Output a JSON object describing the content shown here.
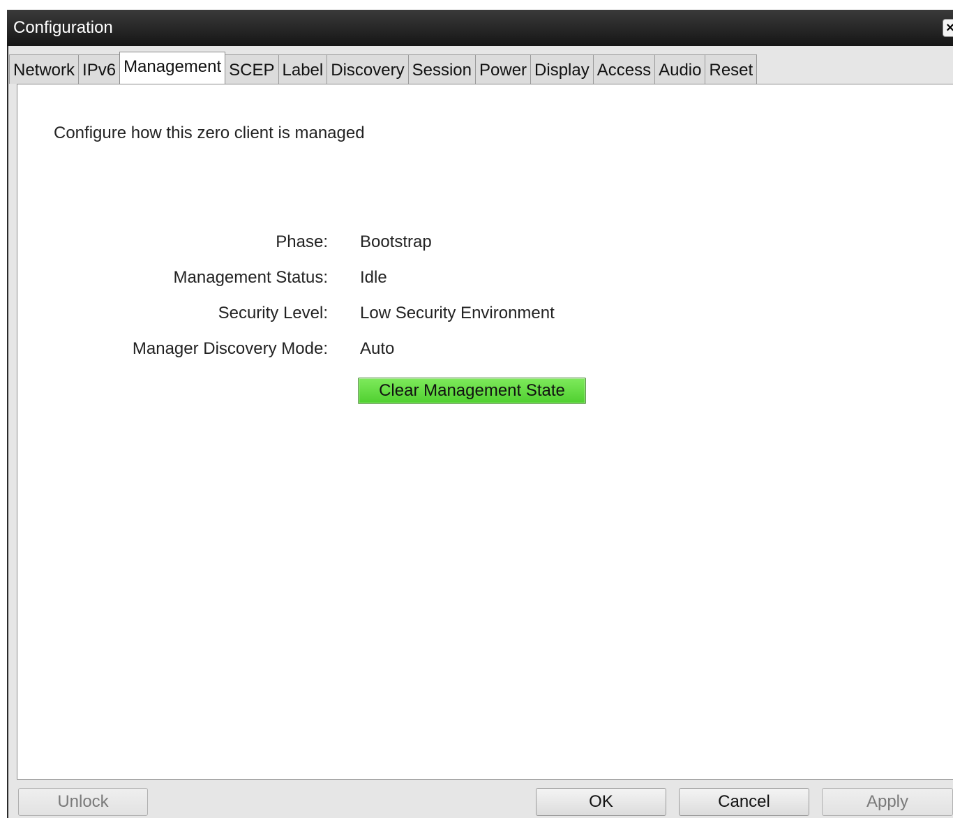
{
  "window": {
    "title": "Configuration",
    "close_glyph": "×"
  },
  "tabs": [
    {
      "label": "Network"
    },
    {
      "label": "IPv6"
    },
    {
      "label": "Management",
      "active": true
    },
    {
      "label": "SCEP"
    },
    {
      "label": "Label"
    },
    {
      "label": "Discovery"
    },
    {
      "label": "Session"
    },
    {
      "label": "Power"
    },
    {
      "label": "Display"
    },
    {
      "label": "Access"
    },
    {
      "label": "Audio"
    },
    {
      "label": "Reset"
    }
  ],
  "panel": {
    "description": "Configure how this zero client is managed",
    "fields": [
      {
        "label": "Phase:",
        "value": "Bootstrap"
      },
      {
        "label": "Management Status:",
        "value": "Idle"
      },
      {
        "label": "Security Level:",
        "value": "Low Security Environment"
      },
      {
        "label": "Manager Discovery Mode:",
        "value": "Auto"
      }
    ],
    "clear_button_label": "Clear Management State",
    "clear_button_color": "#5cd93b"
  },
  "footer": {
    "unlock_label": "Unlock",
    "ok_label": "OK",
    "cancel_label": "Cancel",
    "apply_label": "Apply"
  }
}
